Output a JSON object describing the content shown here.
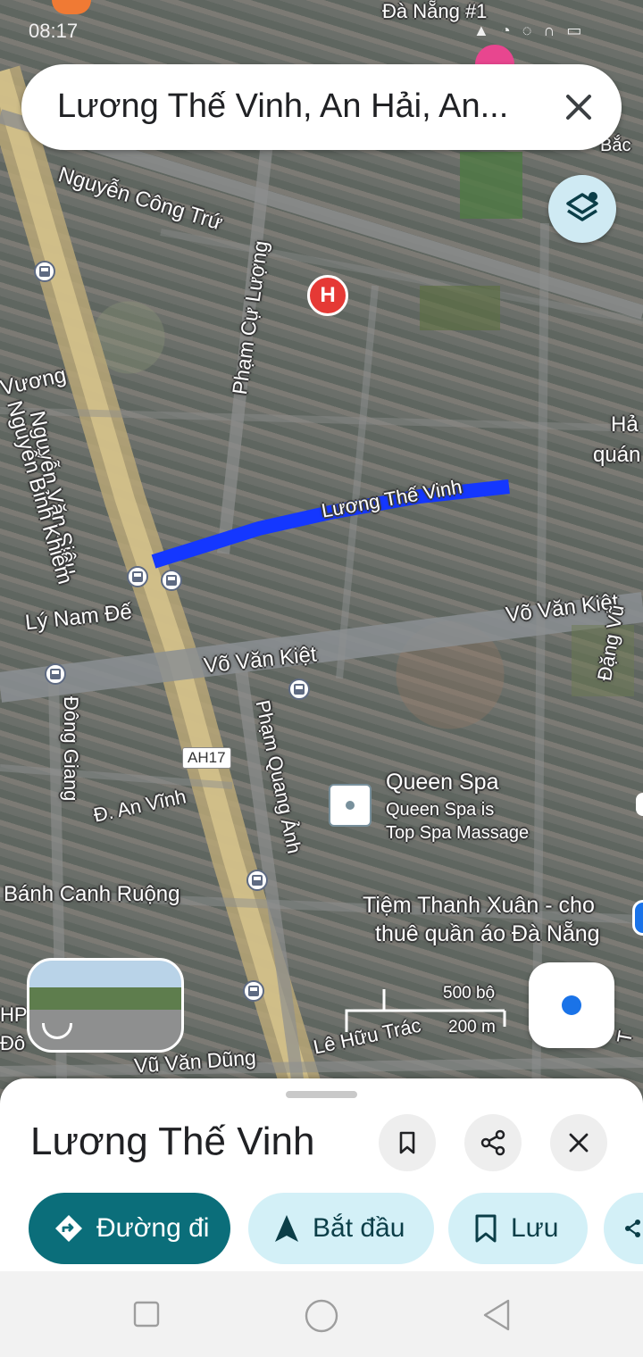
{
  "status_bar": {
    "time": "08:17"
  },
  "search": {
    "query": "Lương Thế Vinh, An Hải, An..."
  },
  "map_labels": {
    "da_nang": "Đà Nẵng #1",
    "nguyen_cong_tru": "Nguyễn Công Trứ",
    "pham_cu_luong": "Phạm Cự Lượng",
    "vuong": "Vương",
    "nguyen_van_sieu": "Nguyễn Văn Siêu",
    "nguyen_binh_khiem": "Nguyễn Bỉnh Khiêm",
    "luong_the_vinh": "Lương Thế Vinh",
    "ly_nam_de": "Lý Nam Đế",
    "vo_van_kiet_left": "Võ Văn Kiệt",
    "vo_van_kiet_right": "Võ Văn Kiệt",
    "dong_giang": "Đông Giang",
    "ah17": "AH17",
    "pham_quang_anh": "Phạm Quang Ảnh",
    "an_vinh": "Đ. An Vĩnh",
    "queen_spa": "Queen Spa",
    "queen_spa_desc_1": "Queen Spa is",
    "queen_spa_desc_2": "Top Spa Massage",
    "banh_canh": "Bánh Canh Ruộng",
    "tiem_1": "Tiệm Thanh Xuân - cho",
    "tiem_2": "thuê quần áo Đà Nẵng",
    "le_huu_trac": "Lê Hữu Trác",
    "vu_van_dung": "Vũ Văn Dũng",
    "dang_vu": "Đặng Vũ",
    "ha": "Hả",
    "quan": "quán",
    "bac": "Bắc",
    "hp": "HP",
    "do": "Đô",
    "t_edge": "T"
  },
  "scale": {
    "imperial": "500 bộ",
    "metric": "200 m"
  },
  "sheet": {
    "title": "Lương Thế Vinh",
    "actions": {
      "directions": "Đường đi",
      "start": "Bắt đầu",
      "save": "Lưu"
    }
  },
  "colors": {
    "accent_teal": "#0b6e7a",
    "chip_bg": "#d3f0f7",
    "route_blue": "#1437ff",
    "location_blue": "#1a73e8",
    "hospital_red": "#e53935"
  },
  "icons": [
    "close-icon",
    "layers-icon",
    "my-location-icon",
    "bookmark-icon",
    "share-icon",
    "directions-icon",
    "navigation-arrow-icon",
    "bus-stop-icon",
    "hospital-icon"
  ]
}
